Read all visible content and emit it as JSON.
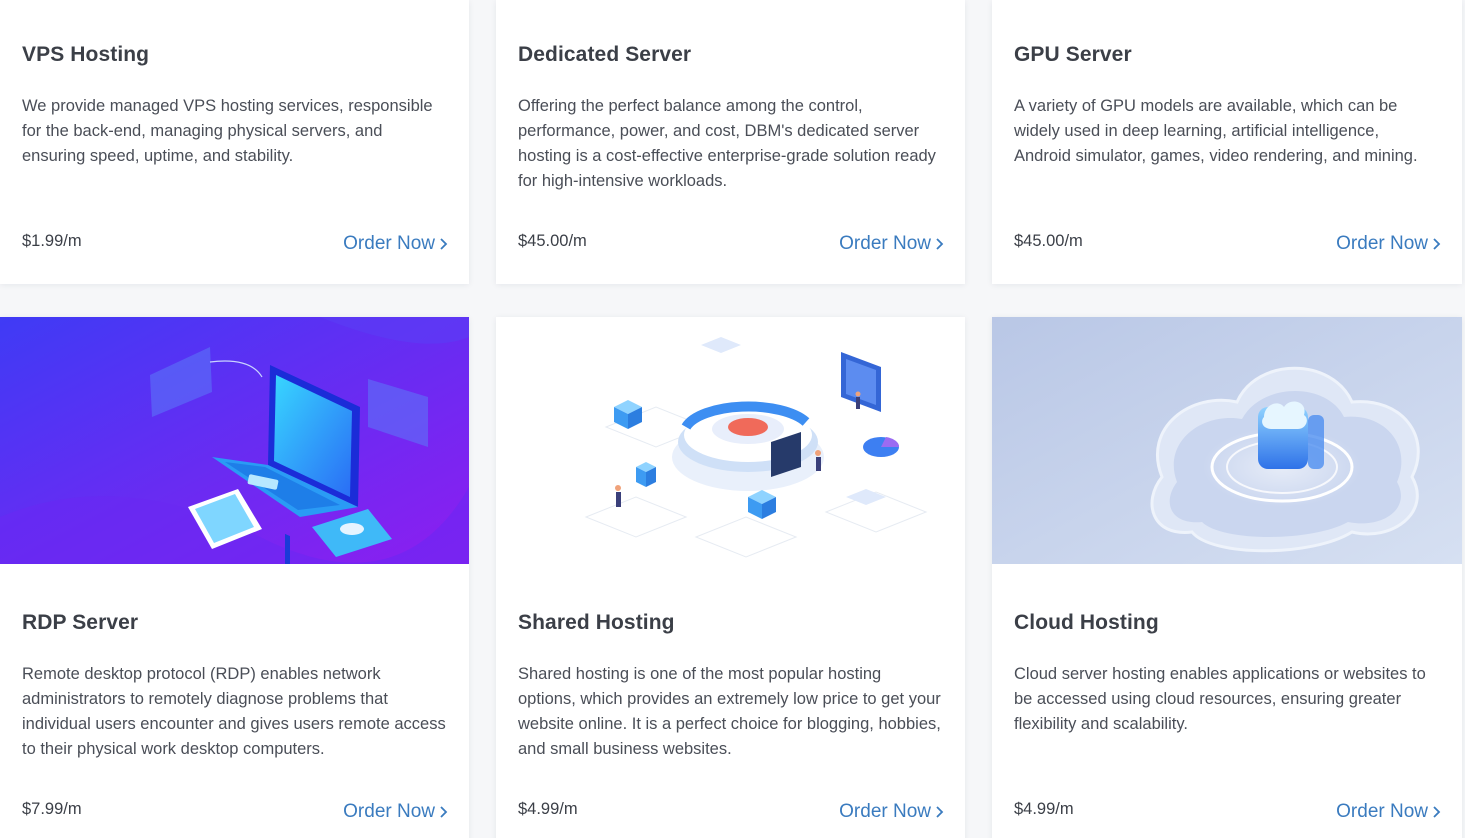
{
  "colors": {
    "title": "#3b3f47",
    "text": "#4a4e57",
    "link": "#3a7bbf",
    "rdp_gradient_start": "#4a2cf0",
    "rdp_gradient_end": "#8a1ff0"
  },
  "cards": [
    {
      "title": "VPS Hosting",
      "description": "We provide managed VPS hosting services, responsible for the back-end, managing physical servers, and ensuring speed, uptime, and stability.",
      "price": "$1.99/m",
      "cta": "Order Now"
    },
    {
      "title": "Dedicated Server",
      "description": "Offering the perfect balance among the control, performance, power, and cost, DBM's dedicated server hosting is a cost-effective enterprise-grade solution ready for high-intensive workloads.",
      "price": "$45.00/m",
      "cta": "Order Now"
    },
    {
      "title": "GPU Server",
      "description": "A variety of GPU models are available, which can be widely used in deep learning, artificial intelligence, Android simulator, games, video rendering, and mining.",
      "price": "$45.00/m",
      "cta": "Order Now"
    },
    {
      "title": "RDP Server",
      "description": "Remote desktop protocol (RDP) enables network administrators to remotely diagnose problems that individual users encounter and gives users remote access to their physical work desktop computers.",
      "price": "$7.99/m",
      "cta": "Order Now",
      "image": "laptop-illustration"
    },
    {
      "title": "Shared Hosting",
      "description": "Shared hosting is one of the most popular hosting options, which provides an extremely low price to get your website online. It is a perfect choice for blogging, hobbies, and small business websites.",
      "price": "$4.99/m",
      "cta": "Order Now",
      "image": "isometric-platform-illustration"
    },
    {
      "title": "Cloud Hosting",
      "description": "Cloud server hosting enables applications or websites to be accessed using cloud resources, ensuring greater flexibility and scalability.",
      "price": "$4.99/m",
      "cta": "Order Now",
      "image": "cloud-illustration"
    }
  ]
}
